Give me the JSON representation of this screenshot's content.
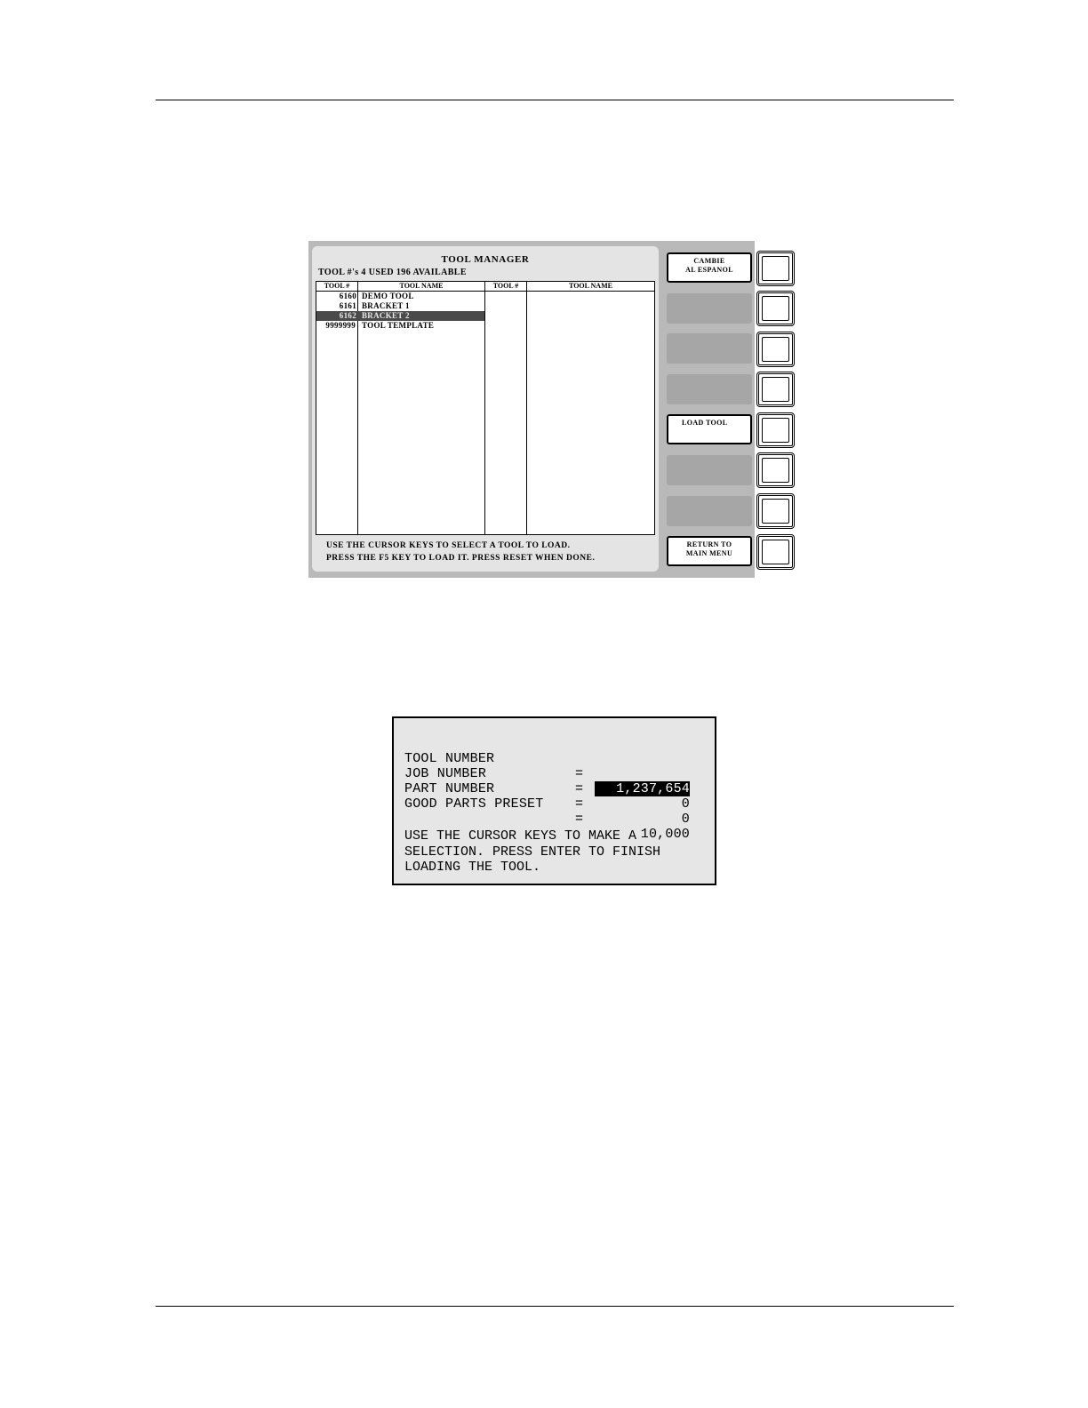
{
  "tool_manager": {
    "title": "TOOL MANAGER",
    "status": "TOOL #'s 4 USED 196 AVAILABLE",
    "left_table": {
      "header_num": "TOOL  #",
      "header_name": "TOOL  NAME",
      "rows": [
        {
          "num": "6160",
          "name": "DEMO TOOL",
          "selected": false
        },
        {
          "num": "6161",
          "name": "BRACKET 1",
          "selected": false
        },
        {
          "num": "6162",
          "name": "BRACKET 2",
          "selected": true
        },
        {
          "num": "9999999",
          "name": "TOOL TEMPLATE",
          "selected": false
        }
      ]
    },
    "right_table": {
      "header_num": "TOOL  #",
      "header_name": "TOOL  NAME"
    },
    "help_line_1": "USE THE CURSOR KEYS TO SELECT A TOOL TO LOAD.",
    "help_line_2": "PRESS THE F5 KEY TO LOAD IT. PRESS RESET WHEN DONE.",
    "softkeys": {
      "f1_line1": "CAMBIE",
      "f1_line2": "AL ESPANOL",
      "f5": "LOAD  TOOL",
      "f8_line1": "RETURN TO",
      "f8_line2": "MAIN MENU"
    }
  },
  "load_dialog": {
    "fields": [
      {
        "label": "TOOL NUMBER",
        "eq": "=",
        "value": "1,237,654"
      },
      {
        "label": "JOB NUMBER",
        "eq": "=",
        "value": "0"
      },
      {
        "label": "PART NUMBER",
        "eq": "=",
        "value": "0"
      },
      {
        "label": "GOOD PARTS PRESET",
        "eq": "=",
        "value": "10,000"
      }
    ],
    "help": "USE THE CURSOR KEYS TO MAKE A\nSELECTION. PRESS ENTER TO FINISH\nLOADING THE TOOL."
  }
}
